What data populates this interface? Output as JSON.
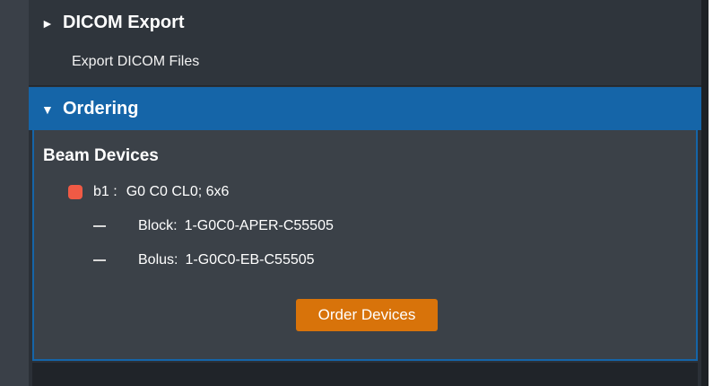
{
  "dicom_export": {
    "arrow": "►",
    "title": "DICOM Export",
    "export_link": "Export DICOM Files"
  },
  "ordering": {
    "arrow": "▼",
    "title": "Ordering",
    "beam_devices_title": "Beam Devices",
    "beam": {
      "label": "b1 :",
      "description": "G0 C0 CL0; 6x6",
      "status_color": "#f05a45"
    },
    "devices": [
      {
        "type": "Block:",
        "id": "1-G0C0-APER-C55505"
      },
      {
        "type": "Bolus:",
        "id": "1-G0C0-EB-C55505"
      }
    ],
    "order_button": "Order Devices"
  },
  "colors": {
    "accent_blue": "#1565a8",
    "button_orange": "#d8730a",
    "panel_bg": "#2b3037"
  }
}
